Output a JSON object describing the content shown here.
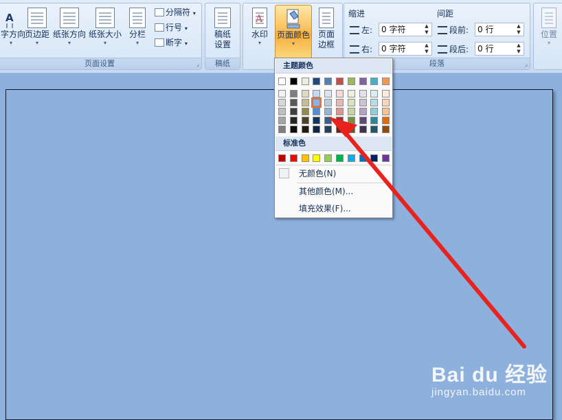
{
  "ribbon": {
    "page_setup": {
      "label": "页面设置",
      "text_direction": "字方向",
      "margins": "页边距",
      "orientation": "纸张方向",
      "size": "纸张大小",
      "columns": "分栏",
      "breaks": "分隔符",
      "line_numbers": "行号",
      "hyphenation": "断字"
    },
    "manuscript": {
      "label": "稿纸",
      "settings_line1": "稿纸",
      "settings_line2": "设置"
    },
    "background": {
      "watermark": "水印",
      "page_color": "页面颜色",
      "borders_line1": "页面",
      "borders_line2": "边框"
    },
    "paragraph": {
      "label": "段落",
      "indent_title": "缩进",
      "left_label": "左:",
      "left_value": "0 字符",
      "right_label": "右:",
      "right_value": "0 字符",
      "spacing_title": "间距",
      "before_label": "段前:",
      "before_value": "0 行",
      "after_label": "段后:",
      "after_value": "0 行"
    },
    "arrange": {
      "position": "位置"
    }
  },
  "palette": {
    "theme_title": "主题颜色",
    "standard_title": "标准色",
    "theme_top": [
      "#ffffff",
      "#000000",
      "#eeece1",
      "#1f497d",
      "#4f81bd",
      "#c0504d",
      "#9bbb59",
      "#8064a2",
      "#4bacc6",
      "#f79646"
    ],
    "theme_shades": [
      [
        "#f2f2f2",
        "#7f7f7f",
        "#ddd9c3",
        "#c6d9f0",
        "#dbe5f1",
        "#f2dcdb",
        "#ebf1dd",
        "#e5e0ec",
        "#dbeef3",
        "#fdeada"
      ],
      [
        "#d8d8d8",
        "#595959",
        "#c4bd97",
        "#8db3e2",
        "#b8cce4",
        "#e5b9b7",
        "#d7e3bc",
        "#ccc1d9",
        "#b7dde8",
        "#fbd5b5"
      ],
      [
        "#bfbfbf",
        "#3f3f3f",
        "#938953",
        "#548dd4",
        "#95b3d7",
        "#d99694",
        "#c3d69b",
        "#b2a2c7",
        "#92cddc",
        "#fac08f"
      ],
      [
        "#a5a5a5",
        "#262626",
        "#494429",
        "#17365d",
        "#366092",
        "#953734",
        "#76923c",
        "#5f497a",
        "#31859b",
        "#e36c09"
      ],
      [
        "#7f7f7f",
        "#0c0c0c",
        "#1d1b10",
        "#0f243e",
        "#244061",
        "#632423",
        "#4f6128",
        "#3f3151",
        "#205867",
        "#974806"
      ]
    ],
    "standard": [
      "#c00000",
      "#ff0000",
      "#ffc000",
      "#ffff00",
      "#92d050",
      "#00b050",
      "#00b0f0",
      "#0070c0",
      "#002060",
      "#7030a0"
    ],
    "selected_swatch": "#8db3e2",
    "no_color": "无颜色(N)",
    "more_colors": "其他颜色(M)...",
    "fill_effects": "填充效果(F)..."
  },
  "document": {
    "page_color": "#8db0dd"
  },
  "annotation": {
    "arrow_color": "#e8231e"
  },
  "watermark": {
    "brand": "Bai du 经验",
    "site": "jingyan.baidu.com"
  }
}
